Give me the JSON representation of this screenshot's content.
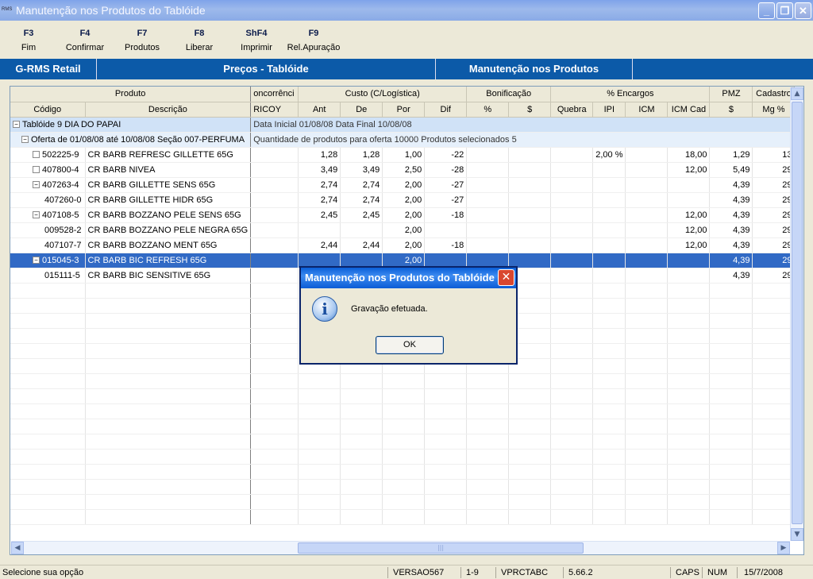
{
  "window": {
    "app_icon": "RMS",
    "title": "Manutenção nos Produtos do Tablóide"
  },
  "toolbar": [
    {
      "key": "F3",
      "label": "Fim"
    },
    {
      "key": "F4",
      "label": "Confirmar"
    },
    {
      "key": "F7",
      "label": "Produtos"
    },
    {
      "key": "F8",
      "label": "Liberar"
    },
    {
      "key": "ShF4",
      "label": "Imprimir"
    },
    {
      "key": "F9",
      "label": "Rel.Apuração"
    }
  ],
  "banner": {
    "app": "G-RMS Retail",
    "module": "Preços - Tablóide",
    "screen": "Manutenção nos Produtos"
  },
  "grid": {
    "group_headers": [
      "Produto",
      "oncorrênci",
      "Custo (C/Logística)",
      "Bonificação",
      "% Encargos",
      "PMZ",
      "Cadastro"
    ],
    "columns": [
      "Código",
      "Descrição",
      "RICOY",
      "Ant",
      "De",
      "Por",
      "Dif",
      "%",
      "$",
      "Quebra",
      "IPI",
      "ICM",
      "ICM Cad",
      "$",
      "Mg %"
    ],
    "tabloide_row": {
      "name": "Tablóide 9 DIA DO PAPAI",
      "info": "Data Inicial 01/08/08  Data Final 10/08/08"
    },
    "oferta_row": {
      "name": "Oferta de 01/08/08 até 10/08/08  Seção 007-PERFUMA",
      "info": "Quantidade de produtos para oferta 10000  Produtos selecionados     5"
    },
    "rows": [
      {
        "tree": "box",
        "code": "502225-9",
        "desc": "CR BARB REFRESC GILLETTE 65G",
        "ant": "1,28",
        "de": "1,28",
        "por": "1,00",
        "dif": "-22",
        "ipi": "2,00 %",
        "icmcad": "18,00",
        "pmz": "1,29",
        "mg": "13"
      },
      {
        "tree": "box",
        "code": "407800-4",
        "desc": "CR BARB NIVEA",
        "ant": "3,49",
        "de": "3,49",
        "por": "2,50",
        "dif": "-28",
        "ipi": "",
        "icmcad": "12,00",
        "pmz": "5,49",
        "mg": "29"
      },
      {
        "tree": "minus",
        "code": "407263-4",
        "desc": "CR BARB GILLETTE SENS 65G",
        "ant": "2,74",
        "de": "2,74",
        "por": "2,00",
        "dif": "-27",
        "ipi": "",
        "icmcad": "",
        "pmz": "4,39",
        "mg": "29"
      },
      {
        "tree": "child",
        "code": "407260-0",
        "desc": "CR BARB GILLETTE HIDR 65G",
        "ant": "2,74",
        "de": "2,74",
        "por": "2,00",
        "dif": "-27",
        "ipi": "",
        "icmcad": "",
        "pmz": "4,39",
        "mg": "29"
      },
      {
        "tree": "minus",
        "code": "407108-5",
        "desc": "CR BARB BOZZANO PELE SENS 65G",
        "ant": "2,45",
        "de": "2,45",
        "por": "2,00",
        "dif": "-18",
        "ipi": "",
        "icmcad": "12,00",
        "pmz": "4,39",
        "mg": "29"
      },
      {
        "tree": "child",
        "code": "009528-2",
        "desc": "CR BARB BOZZANO PELE NEGRA 65G",
        "ant": "",
        "de": "",
        "por": "2,00",
        "dif": "",
        "ipi": "",
        "icmcad": "12,00",
        "pmz": "4,39",
        "mg": "29"
      },
      {
        "tree": "child",
        "code": "407107-7",
        "desc": "CR BARB BOZZANO MENT 65G",
        "ant": "2,44",
        "de": "2,44",
        "por": "2,00",
        "dif": "-18",
        "ipi": "",
        "icmcad": "12,00",
        "pmz": "4,39",
        "mg": "29"
      },
      {
        "tree": "minus",
        "code": "015045-3",
        "desc": "CR BARB BIC REFRESH 65G",
        "ant": "",
        "de": "",
        "por": "2,00",
        "dif": "",
        "ipi": "",
        "icmcad": "",
        "pmz": "4,39",
        "mg": "29",
        "selected": true
      },
      {
        "tree": "child",
        "code": "015111-5",
        "desc": "CR BARB BIC SENSITIVE 65G",
        "ant": "",
        "de": "",
        "por": "",
        "dif": "",
        "ipi": "",
        "icmcad": "",
        "pmz": "4,39",
        "mg": "29"
      }
    ]
  },
  "dialog": {
    "title": "Manutenção nos Produtos do Tablóide",
    "message": "Gravação efetuada.",
    "ok": "OK",
    "icon": "info-icon"
  },
  "status": {
    "hint": "Selecione sua opção",
    "version": "VERSAO567",
    "range": "1-9",
    "program": "VPRCTABC",
    "build": "5.66.2",
    "caps": "CAPS",
    "num": "NUM",
    "date": "15/7/2008"
  },
  "colors": {
    "banner": "#0C5AA8",
    "selection": "#316AC5",
    "group_row": "#D0E2F7"
  }
}
